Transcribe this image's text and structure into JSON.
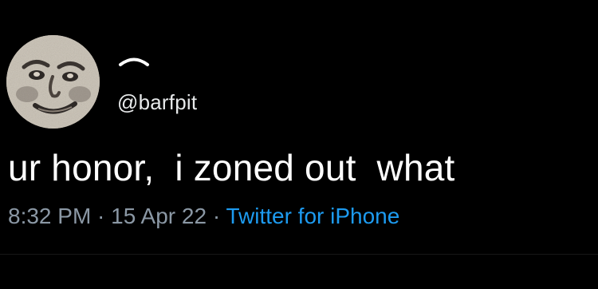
{
  "tweet": {
    "handle": "@barfpit",
    "text": "ur honor,  i zoned out  what",
    "time": "8:32 PM",
    "separator": " · ",
    "date": "15 Apr 22",
    "source": "Twitter for iPhone"
  },
  "colors": {
    "background": "#000000",
    "text": "#ffffff",
    "meta": "#8b98a5",
    "link": "#1d9bf0"
  }
}
